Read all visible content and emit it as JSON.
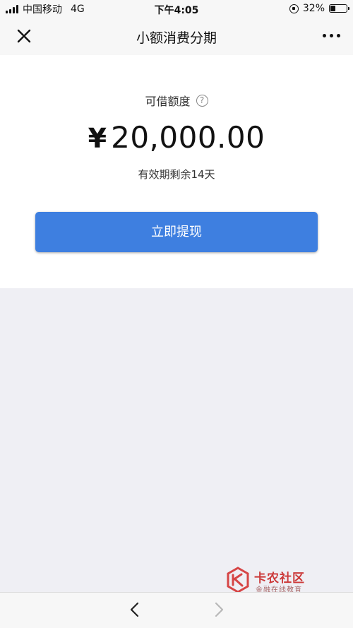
{
  "status_bar": {
    "carrier": "中国移动",
    "network": "4G",
    "time": "下午4:05",
    "battery_percent": "32%",
    "battery_level": 0.32
  },
  "nav": {
    "title": "小额消费分期",
    "close_icon": "close-icon",
    "more_icon": "more-dots-icon"
  },
  "credit": {
    "label": "可借额度",
    "help_symbol": "?",
    "currency_symbol": "¥",
    "amount": "20,000.00",
    "validity": "有效期剩余14天"
  },
  "actions": {
    "withdraw_label": "立即提现"
  },
  "watermark": {
    "title": "卡农社区",
    "subtitle": "金融在线教育"
  },
  "colors": {
    "accent": "#3e7fe0",
    "background": "#efeff4",
    "card": "#ffffff",
    "watermark": "#cc3a3a"
  }
}
